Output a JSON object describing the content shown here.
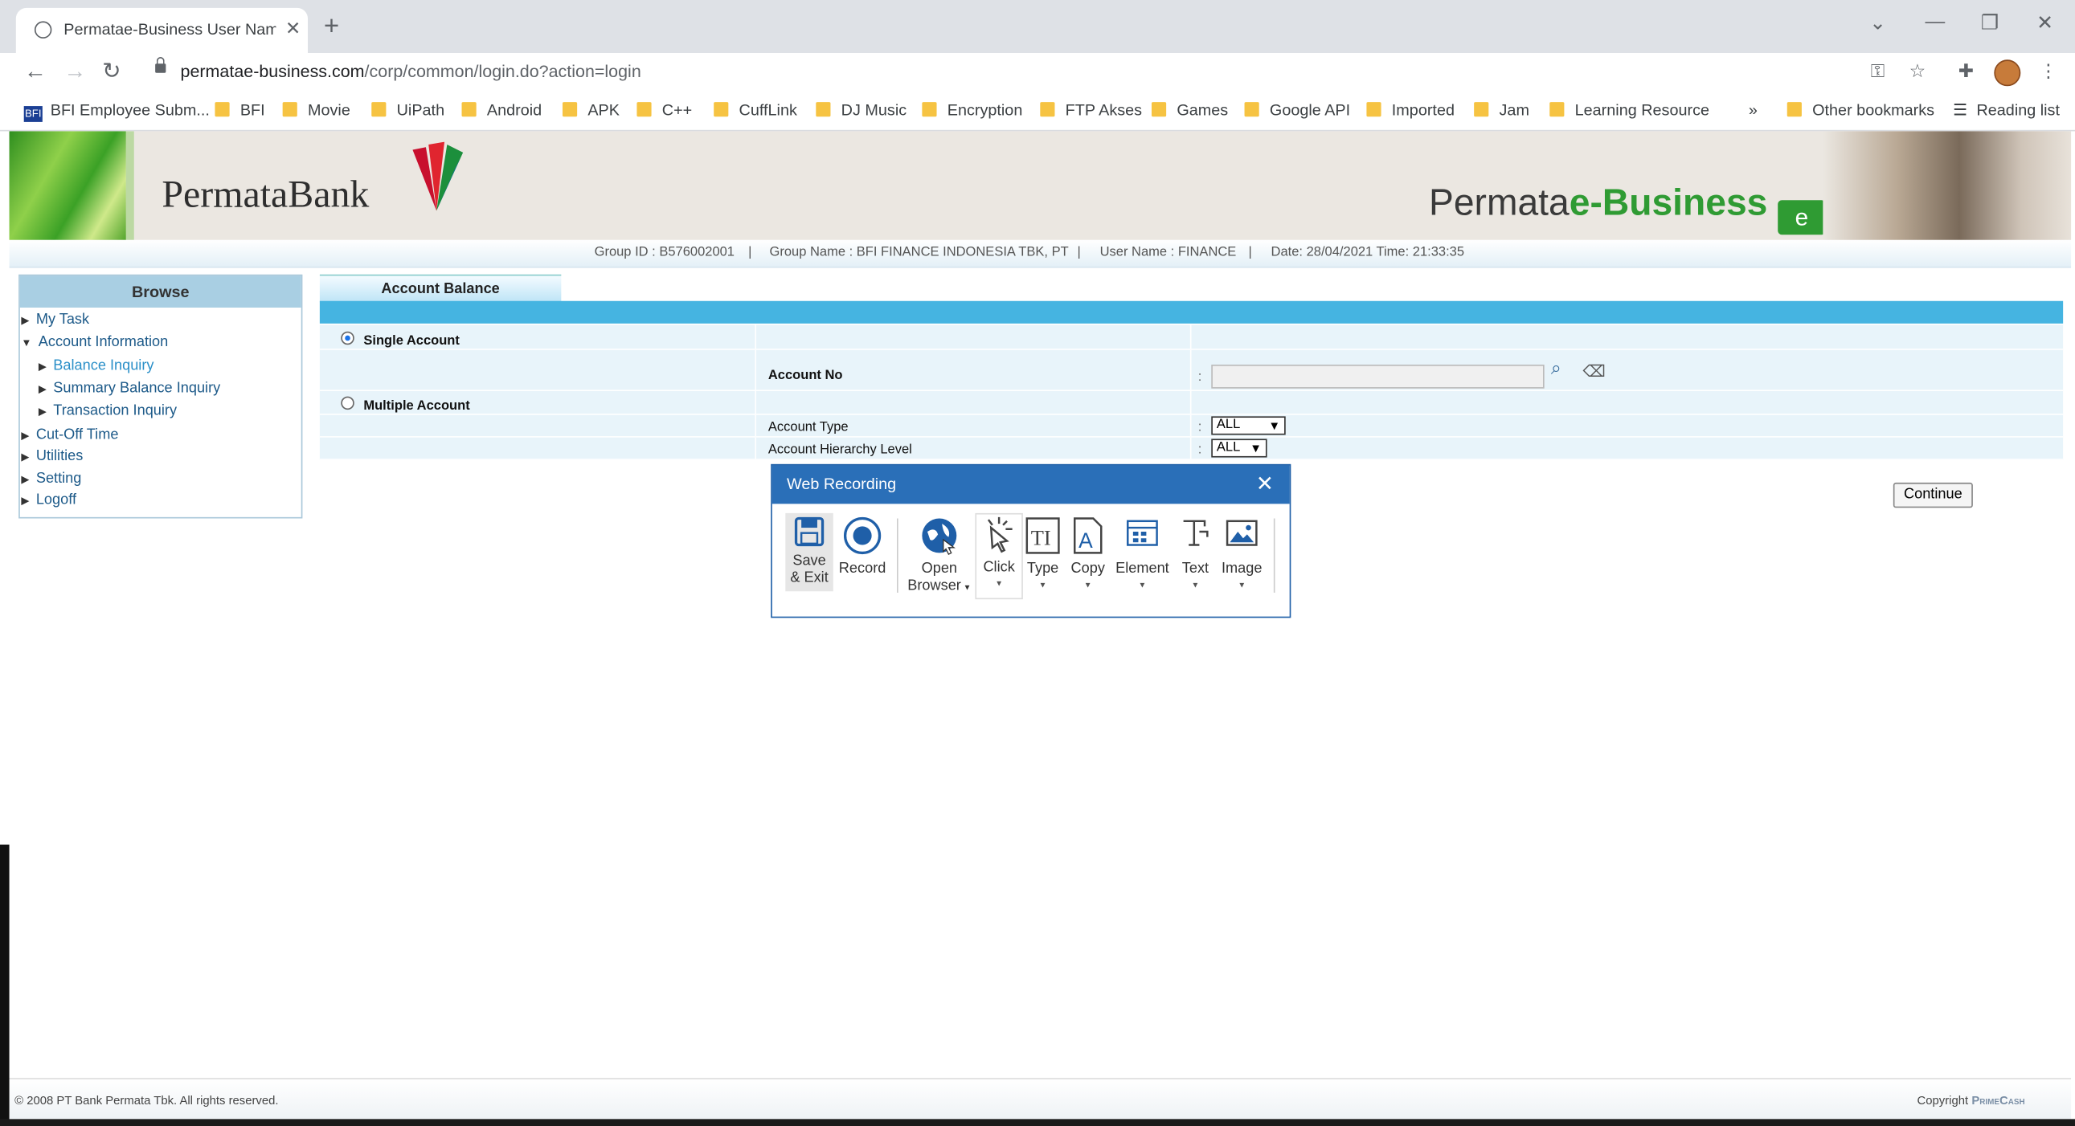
{
  "browser": {
    "tab_title": "Permatae-Business User Name : l",
    "url_host": "permatae-business.com",
    "url_path": "/corp/common/login.do?action=login",
    "bookmarks": [
      "BFI Employee Subm...",
      "BFI",
      "Movie",
      "UiPath",
      "Android",
      "APK",
      "C++",
      "CuffLink",
      "DJ Music",
      "Encryption",
      "FTP Akses",
      "Games",
      "Google API",
      "Imported",
      "Jam",
      "Learning Resource"
    ],
    "overflow": "»",
    "other_bookmarks": "Other bookmarks",
    "reading_list": "Reading list"
  },
  "banner": {
    "bank_name": "PermataBank",
    "product_prefix": "Permata",
    "product_suffix": "e-Business",
    "badge": "e"
  },
  "info": {
    "group_id": "Group ID : B576002001",
    "group_name": "Group Name : BFI FINANCE INDONESIA TBK, PT",
    "user_name": "User Name : FINANCE",
    "datetime": "Date: 28/04/2021 Time: 21:33:35",
    "divider": "|"
  },
  "sidebar": {
    "title": "Browse",
    "items": {
      "my_task": "My Task",
      "account_info": "Account Information",
      "balance_inquiry": "Balance Inquiry",
      "summary_balance": "Summary Balance Inquiry",
      "transaction_inquiry": "Transaction Inquiry",
      "cutoff": "Cut-Off Time",
      "utilities": "Utilities",
      "setting": "Setting",
      "logoff": "Logoff"
    }
  },
  "content": {
    "tab": "Account Balance",
    "single_account": "Single Account",
    "multiple_account": "Multiple Account",
    "account_no": "Account No",
    "account_type": "Account Type",
    "account_hierarchy": "Account Hierarchy Level",
    "colon": ":",
    "account_type_value": "ALL",
    "hierarchy_value": "ALL",
    "continue": "Continue"
  },
  "dialog": {
    "title": "Web Recording",
    "tools": {
      "save_1": "Save",
      "save_2": "& Exit",
      "record": "Record",
      "open_1": "Open",
      "open_2": "Browser",
      "click": "Click",
      "type": "Type",
      "copy": "Copy",
      "element": "Element",
      "text": "Text",
      "image": "Image"
    }
  },
  "footer": {
    "copyright": "© 2008 PT Bank Permata Tbk. All rights reserved.",
    "copyright_right_prefix": "Copyright",
    "copyright_right_brand": "PrimeCash"
  },
  "colors": {
    "accent_blue": "#45b4e1",
    "dialog_header": "#2a6fb8",
    "brand_green": "#2f9b33"
  }
}
